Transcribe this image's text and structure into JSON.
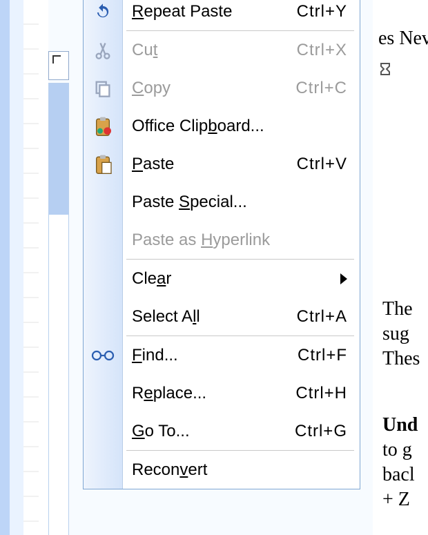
{
  "menu": {
    "items": [
      {
        "key": "repeat",
        "label_pre": "",
        "u": "R",
        "label_post": "epeat Paste",
        "shortcut": "Ctrl+Y",
        "icon": "repeat-icon",
        "enabled": true,
        "sep_after": true
      },
      {
        "key": "cut",
        "label_pre": "Cu",
        "u": "t",
        "label_post": "",
        "shortcut": "Ctrl+X",
        "icon": "cut-icon",
        "enabled": false
      },
      {
        "key": "copy",
        "label_pre": "",
        "u": "C",
        "label_post": "opy",
        "shortcut": "Ctrl+C",
        "icon": "copy-icon",
        "enabled": false
      },
      {
        "key": "officecb",
        "label_pre": "Office Clip",
        "u": "b",
        "label_post": "oard...",
        "icon": "clipboard-options-icon",
        "enabled": true
      },
      {
        "key": "paste",
        "label_pre": "",
        "u": "P",
        "label_post": "aste",
        "shortcut": "Ctrl+V",
        "icon": "paste-icon",
        "enabled": true
      },
      {
        "key": "pastesp",
        "label_pre": "Paste ",
        "u": "S",
        "label_post": "pecial...",
        "enabled": true
      },
      {
        "key": "pastehy",
        "label_pre": "Paste as ",
        "u": "H",
        "label_post": "yperlink",
        "enabled": false,
        "sep_after": true
      },
      {
        "key": "clear",
        "label_pre": "Cle",
        "u": "a",
        "label_post": "r",
        "enabled": true,
        "submenu": true
      },
      {
        "key": "selall",
        "label_pre": "Select A",
        "u": "l",
        "label_post": "l",
        "shortcut": "Ctrl+A",
        "enabled": true,
        "sep_after": true
      },
      {
        "key": "find",
        "label_pre": "",
        "u": "F",
        "label_post": "ind...",
        "shortcut": "Ctrl+F",
        "icon": "find-icon",
        "enabled": true
      },
      {
        "key": "replace",
        "label_pre": "R",
        "u": "e",
        "label_post": "place...",
        "shortcut": "Ctrl+H",
        "enabled": true
      },
      {
        "key": "goto",
        "label_pre": "",
        "u": "G",
        "label_post": "o To...",
        "shortcut": "Ctrl+G",
        "enabled": true,
        "sep_after": true
      },
      {
        "key": "reconv",
        "label_pre": "Recon",
        "u": "v",
        "label_post": "ert",
        "enabled": true
      }
    ]
  },
  "document": {
    "top_fragment": "es Nev",
    "para1": [
      "The",
      "sug",
      "Thes"
    ],
    "para2": [
      "Und",
      "to g",
      "bacl",
      "+ Z"
    ]
  },
  "icons": {
    "repeat": "↻",
    "cut": "✂",
    "copy": "⎘",
    "clipboard_options": "📋",
    "paste": "📋",
    "find": "👓"
  }
}
